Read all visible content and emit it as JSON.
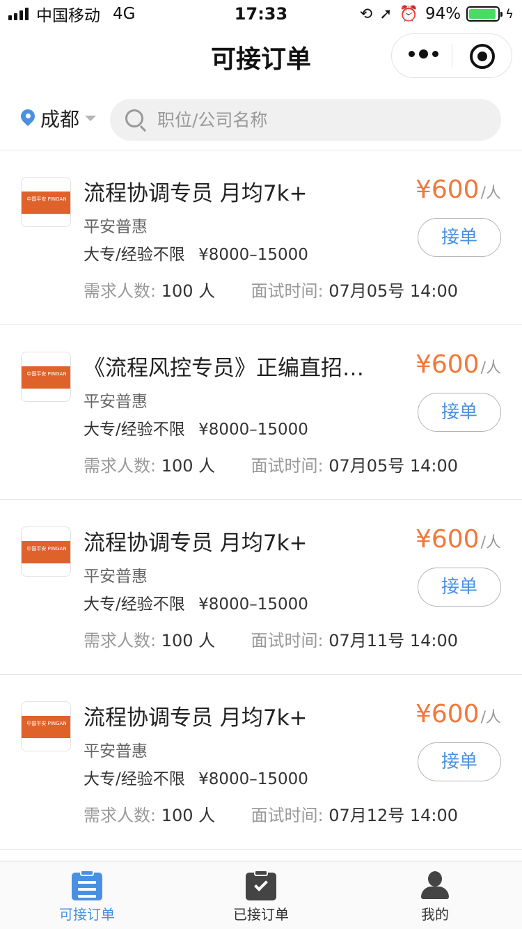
{
  "status_bar": {
    "carrier": "中国移动",
    "network": "4G",
    "time": "17:33",
    "battery": "94%",
    "battery_level": 0.94
  },
  "nav": {
    "title": "可接订单"
  },
  "search": {
    "city": "成都",
    "placeholder": "职位/公司名称"
  },
  "colors": {
    "accent": "#4a90e2",
    "price": "#f0783a",
    "brand_logo": "#e0622b"
  },
  "jobs": [
    {
      "title": "流程协调专员 月均7k+",
      "company": "平安普惠",
      "requirement": "大专/经验不限",
      "salary": "¥8000–15000",
      "price": "¥600",
      "price_unit": "/人",
      "button": "接单",
      "headcount_label": "需求人数:",
      "headcount": "100 人",
      "interview_label": "面试时间:",
      "interview_time": "07月05号 14:00",
      "logo_text": "中国平安 PINGAN"
    },
    {
      "title": "《流程风控专员》正编直招…",
      "company": "平安普惠",
      "requirement": "大专/经验不限",
      "salary": "¥8000–15000",
      "price": "¥600",
      "price_unit": "/人",
      "button": "接单",
      "headcount_label": "需求人数:",
      "headcount": "100 人",
      "interview_label": "面试时间:",
      "interview_time": "07月05号 14:00",
      "logo_text": "中国平安 PINGAN"
    },
    {
      "title": "流程协调专员 月均7k+",
      "company": "平安普惠",
      "requirement": "大专/经验不限",
      "salary": "¥8000–15000",
      "price": "¥600",
      "price_unit": "/人",
      "button": "接单",
      "headcount_label": "需求人数:",
      "headcount": "100 人",
      "interview_label": "面试时间:",
      "interview_time": "07月11号 14:00",
      "logo_text": "中国平安 PINGAN"
    },
    {
      "title": "流程协调专员 月均7k+",
      "company": "平安普惠",
      "requirement": "大专/经验不限",
      "salary": "¥8000–15000",
      "price": "¥600",
      "price_unit": "/人",
      "button": "接单",
      "headcount_label": "需求人数:",
      "headcount": "100 人",
      "interview_label": "面试时间:",
      "interview_time": "07月12号 14:00",
      "logo_text": "中国平安 PINGAN"
    }
  ],
  "tabbar": {
    "tabs": [
      {
        "label": "可接订单",
        "icon": "clipboard-list-icon",
        "active": true
      },
      {
        "label": "已接订单",
        "icon": "clipboard-check-icon",
        "active": false
      },
      {
        "label": "我的",
        "icon": "user-icon",
        "active": false
      }
    ]
  }
}
